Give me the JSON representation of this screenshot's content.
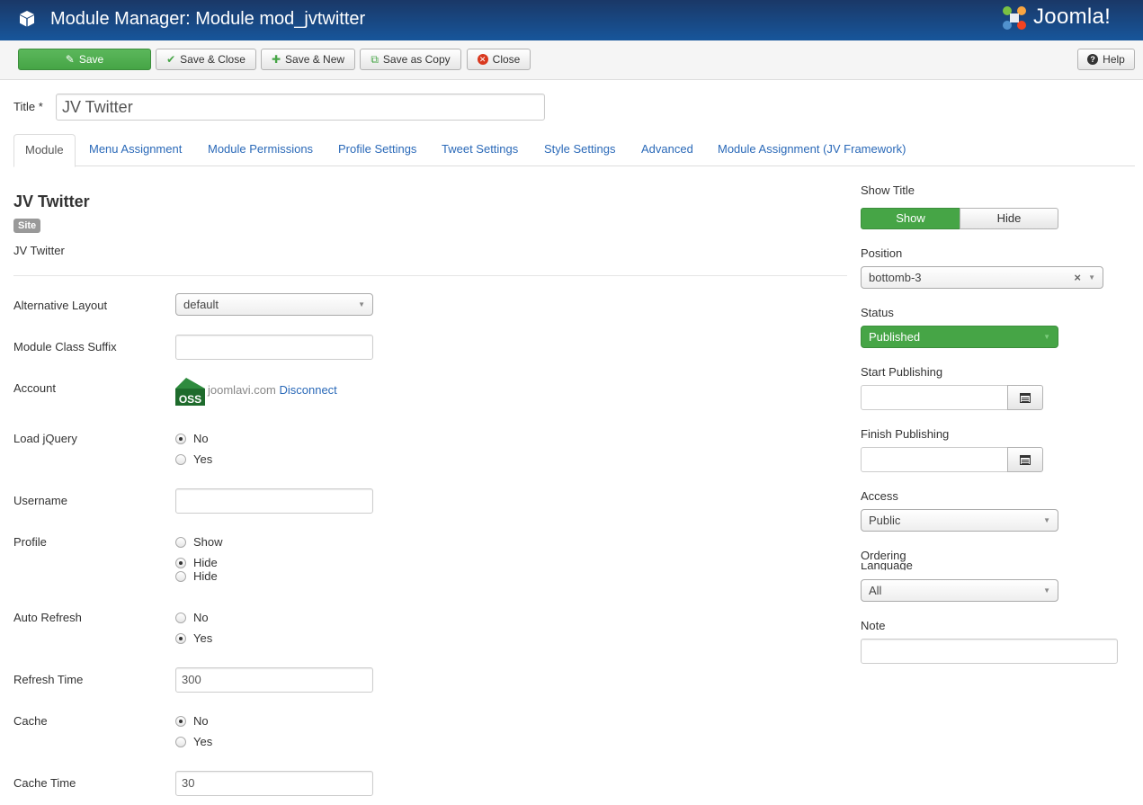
{
  "header": {
    "title": "Module Manager: Module mod_jvtwitter",
    "logo_text": "Joomla!"
  },
  "toolbar": {
    "save": "Save",
    "save_close": "Save & Close",
    "save_new": "Save & New",
    "save_copy": "Save as Copy",
    "close": "Close",
    "help": "Help"
  },
  "title_field": {
    "label": "Title *",
    "value": "JV Twitter"
  },
  "tabs": [
    "Module",
    "Menu Assignment",
    "Module Permissions",
    "Profile Settings",
    "Tweet Settings",
    "Style Settings",
    "Advanced",
    "Module Assignment (JV Framework)"
  ],
  "module": {
    "heading": "JV Twitter",
    "badge": "Site",
    "description": "JV Twitter"
  },
  "fields": {
    "alt_layout": {
      "label": "Alternative Layout",
      "value": "default"
    },
    "class_suffix": {
      "label": "Module Class Suffix",
      "value": ""
    },
    "account": {
      "label": "Account",
      "domain": "joomlavi.com",
      "link": "Disconnect"
    },
    "load_jquery": {
      "label": "Load jQuery",
      "options": [
        "No",
        "Yes"
      ],
      "selected": "No"
    },
    "username": {
      "label": "Username",
      "value": ""
    },
    "profile": {
      "label": "Profile",
      "options": [
        "Show",
        "Hide",
        "Hide"
      ],
      "selected_index": 1
    },
    "auto_refresh": {
      "label": "Auto Refresh",
      "options": [
        "No",
        "Yes"
      ],
      "selected": "Yes"
    },
    "refresh_time": {
      "label": "Refresh Time",
      "value": "300"
    },
    "cache": {
      "label": "Cache",
      "options": [
        "No",
        "Yes"
      ],
      "selected": "No"
    },
    "cache_time": {
      "label": "Cache Time",
      "value": "30"
    }
  },
  "sidebar": {
    "show_title": {
      "label": "Show Title",
      "show": "Show",
      "hide": "Hide",
      "selected": "Show"
    },
    "position": {
      "label": "Position",
      "value": "bottomb-3"
    },
    "status": {
      "label": "Status",
      "value": "Published"
    },
    "start_publishing": {
      "label": "Start Publishing",
      "value": ""
    },
    "finish_publishing": {
      "label": "Finish Publishing",
      "value": ""
    },
    "access": {
      "label": "Access",
      "value": "Public"
    },
    "ordering": {
      "label": "Ordering",
      "overlap_label": "Language"
    },
    "language": {
      "value": "All"
    },
    "note": {
      "label": "Note",
      "value": ""
    }
  },
  "colors": {
    "header_bg": "#1a3867",
    "primary_green": "#46a546",
    "link_blue": "#2a69b8"
  }
}
